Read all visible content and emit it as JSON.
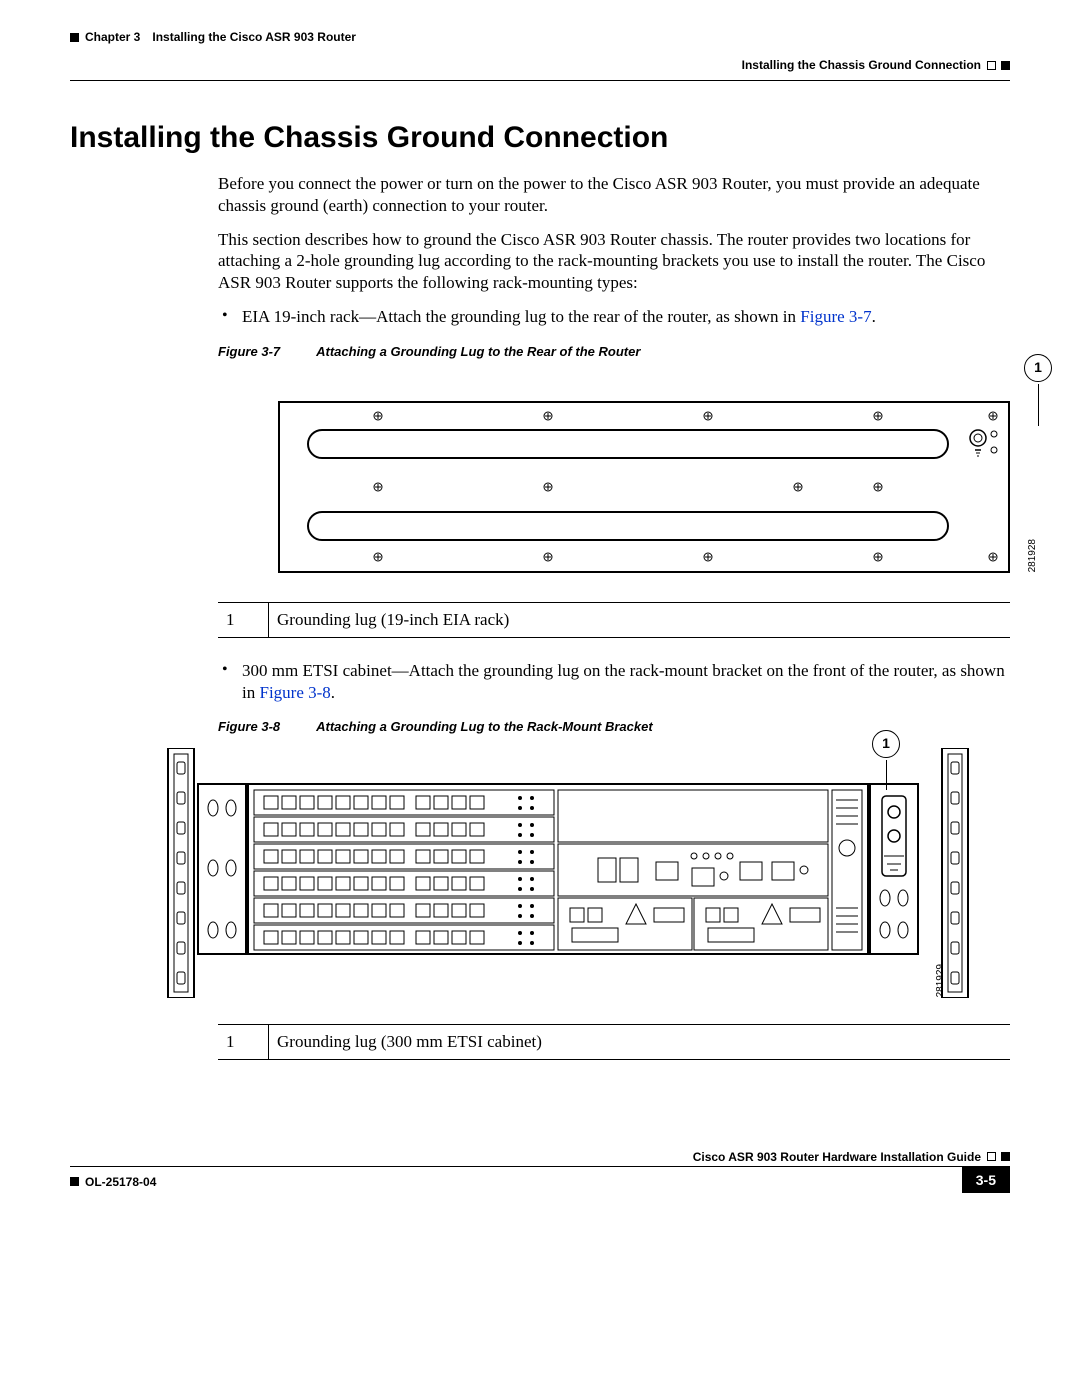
{
  "header": {
    "chapter": "Chapter 3",
    "chapter_title": "Installing the Cisco ASR 903 Router",
    "section": "Installing the Chassis Ground Connection"
  },
  "heading": "Installing the Chassis Ground Connection",
  "para1": "Before you connect the power or turn on the power to the Cisco ASR 903 Router, you must provide an adequate chassis ground (earth) connection to your router.",
  "para2": "This section describes how to ground the Cisco ASR 903 Router chassis. The router provides two locations for attaching a 2-hole grounding lug according to the rack-mounting brackets you use to install the router. The Cisco ASR 903 Router supports the following rack-mounting types:",
  "bullet1_a": "EIA 19-inch rack—Attach the grounding lug to the rear of the router, as shown in ",
  "bullet1_link": "Figure 3-7",
  "bullet1_b": ".",
  "fig37": {
    "label": "Figure 3-7",
    "caption": "Attaching a Grounding Lug to the Rear of the Router",
    "callout": "1",
    "id": "281928"
  },
  "legend37_num": "1",
  "legend37_text": "Grounding lug (19-inch EIA rack)",
  "bullet2_a": "300 mm ETSI cabinet—Attach the grounding lug on the rack-mount bracket on the front of the router, as shown in ",
  "bullet2_link": "Figure 3-8",
  "bullet2_b": ".",
  "fig38": {
    "label": "Figure 3-8",
    "caption": "Attaching a Grounding Lug to the Rack-Mount Bracket",
    "callout": "1",
    "id": "281929"
  },
  "legend38_num": "1",
  "legend38_text": "Grounding lug (300 mm ETSI cabinet)",
  "footer": {
    "guide": "Cisco ASR 903 Router Hardware Installation Guide",
    "docnum": "OL-25178-04",
    "page": "3-5"
  }
}
